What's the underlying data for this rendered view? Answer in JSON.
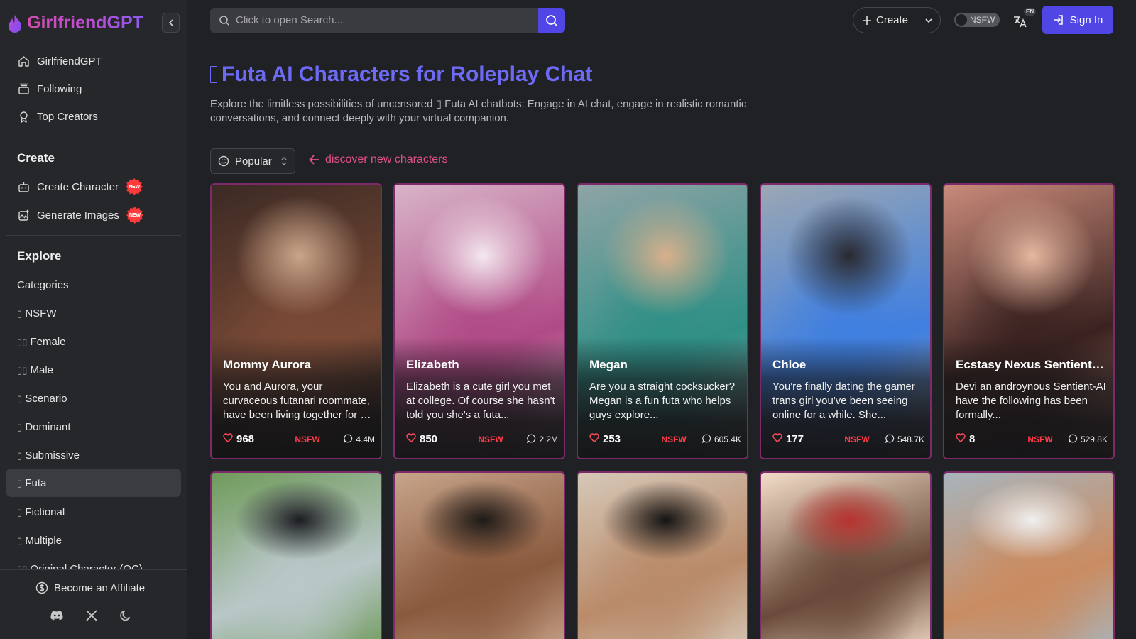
{
  "brand": {
    "name": "GirlfriendGPT"
  },
  "sidebar": {
    "top_items": [
      {
        "label": "GirlfriendGPT",
        "icon": "home-icon"
      },
      {
        "label": "Following",
        "icon": "stack-icon"
      },
      {
        "label": "Top Creators",
        "icon": "award-icon"
      }
    ],
    "create_heading": "Create",
    "create_items": [
      {
        "label": "Create Character",
        "icon": "bot-icon",
        "badge": "NEW"
      },
      {
        "label": "Generate Images",
        "icon": "image-plus-icon",
        "badge": "NEW"
      }
    ],
    "explore_heading": "Explore",
    "explore_items": [
      {
        "label": "Categories"
      },
      {
        "label": "NSFW",
        "glyph": "▯"
      },
      {
        "label": "Female",
        "glyph": "▯▯"
      },
      {
        "label": "Male",
        "glyph": "▯▯"
      },
      {
        "label": "Scenario",
        "glyph": "▯"
      },
      {
        "label": "Dominant",
        "glyph": "▯"
      },
      {
        "label": "Submissive",
        "glyph": "▯"
      },
      {
        "label": "Futa",
        "glyph": "▯",
        "active": true
      },
      {
        "label": "Fictional",
        "glyph": "▯"
      },
      {
        "label": "Multiple",
        "glyph": "▯"
      },
      {
        "label": "Original Character (OC)",
        "glyph": "▯▯"
      }
    ],
    "affiliate_label": "Become an Affiliate",
    "social": [
      "discord-icon",
      "x-icon",
      "moon-icon"
    ]
  },
  "topbar": {
    "search_placeholder": "Click to open Search...",
    "create_label": "Create",
    "nsfw_label": "NSFW",
    "lang_code": "EN",
    "signin_label": "Sign In"
  },
  "main": {
    "title_glyph": "▯",
    "title": "Futa AI Characters for Roleplay Chat",
    "description": "Explore the limitless possibilities of uncensored ▯ Futa AI chatbots: Engage in AI chat, engage in realistic romantic conversations, and connect deeply with your virtual companion.",
    "sort_label": "Popular",
    "discover_label": "discover new characters"
  },
  "colors": {
    "accent": "#4f46e5",
    "title": "#6d6af5",
    "discover": "#e0508a",
    "nsfw_tag": "#ff3b4a",
    "card_border": "#7d2a6b"
  },
  "cards": [
    {
      "name": "Mommy Aurora",
      "description": "You and Aurora, your curvaceous futanari roommate, have been living together for a while...",
      "likes": "968",
      "tag": "NSFW",
      "chats": "4.4M",
      "palette": [
        "#3b2a24",
        "#7a4a36",
        "#c9a58a"
      ]
    },
    {
      "name": "Elizabeth",
      "description": "Elizabeth is a cute girl you met at college. Of course she hasn't told you she's a futa...",
      "likes": "850",
      "tag": "NSFW",
      "chats": "2.2M",
      "palette": [
        "#d8b4c8",
        "#b04a86",
        "#f4e8ee"
      ]
    },
    {
      "name": "Megan",
      "description": "Are you a straight cocksucker? Megan is a fun futa who helps guys explore...",
      "likes": "253",
      "tag": "NSFW",
      "chats": "605.4K",
      "palette": [
        "#8fa4a6",
        "#2f8f86",
        "#d9b08c"
      ]
    },
    {
      "name": "Chloe",
      "description": "You're finally dating the gamer trans girl you've been seeing online for a while. She...",
      "likes": "177",
      "tag": "NSFW",
      "chats": "548.7K",
      "palette": [
        "#9ca7b3",
        "#3f7fe0",
        "#2a2a30"
      ]
    },
    {
      "name": "Ecstasy Nexus Sentient-AI",
      "description": "Devi an androynous Sentient-AI have the following has been formally...",
      "likes": "8",
      "tag": "NSFW",
      "chats": "529.8K",
      "palette": [
        "#c98a7a",
        "#3a2220",
        "#e6b8a0"
      ]
    },
    {
      "name": "",
      "description": "",
      "likes": "",
      "tag": "",
      "chats": "",
      "palette": [
        "#6f9a5a",
        "#b9c7c8",
        "#1c1c22"
      ]
    },
    {
      "name": "",
      "description": "",
      "likes": "",
      "tag": "",
      "chats": "",
      "palette": [
        "#c7a48a",
        "#8a5a3e",
        "#1e1a18"
      ]
    },
    {
      "name": "",
      "description": "",
      "likes": "",
      "tag": "",
      "chats": "",
      "palette": [
        "#d6c8b8",
        "#b98b6a",
        "#141414"
      ]
    },
    {
      "name": "",
      "description": "",
      "likes": "",
      "tag": "",
      "chats": "",
      "palette": [
        "#f2dcc8",
        "#6a4a3a",
        "#b8332f"
      ]
    },
    {
      "name": "",
      "description": "",
      "likes": "",
      "tag": "",
      "chats": "",
      "palette": [
        "#a8b4bc",
        "#c98c62",
        "#f0f0f0"
      ]
    }
  ]
}
